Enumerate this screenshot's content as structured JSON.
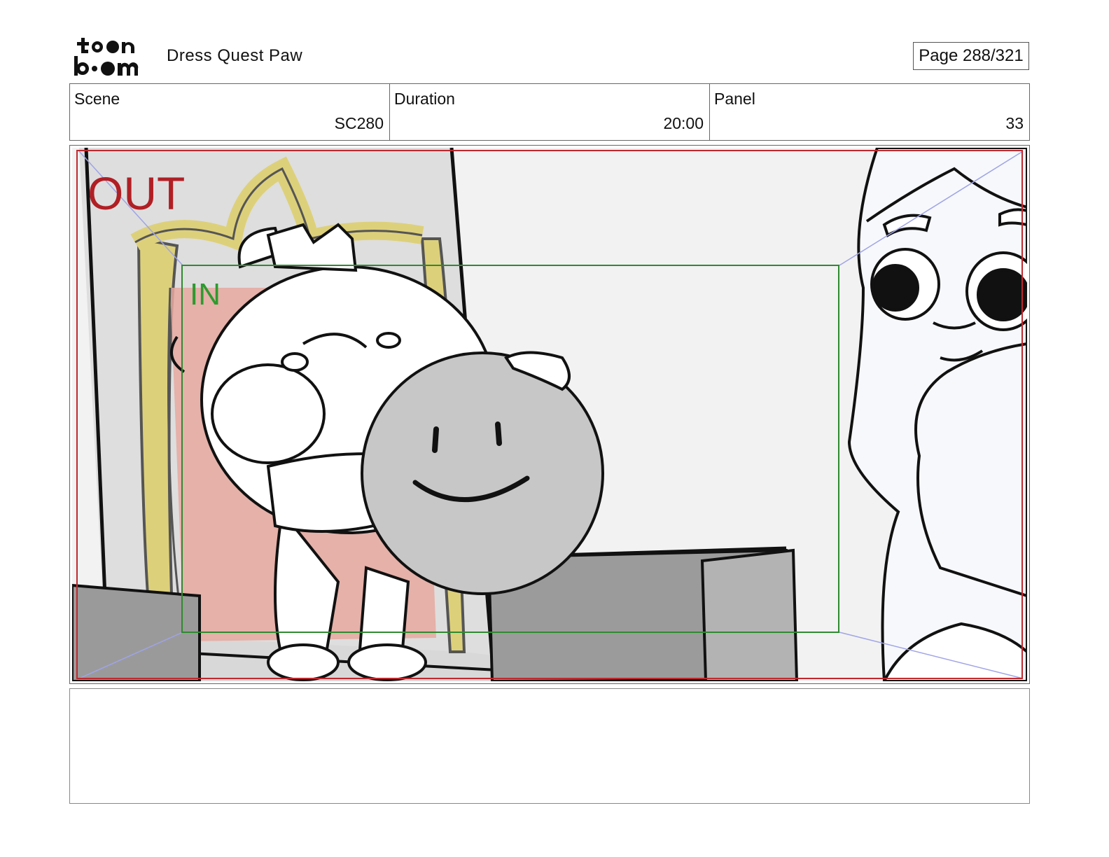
{
  "header": {
    "logo_text_top": "toon",
    "logo_text_bottom": "boom",
    "project_title": "Dress Quest Paw",
    "page_indicator": "Page 288/321"
  },
  "info": {
    "scene_label": "Scene",
    "scene_value": "SC280",
    "duration_label": "Duration",
    "duration_value": "20:00",
    "panel_label": "Panel",
    "panel_value": "33"
  },
  "panel": {
    "out_label": "OUT",
    "in_label": "IN"
  },
  "colors": {
    "out_frame": "#c0282d",
    "in_frame": "#2f8a2f",
    "throne_gold": "#ddd07a",
    "throne_red": "#e6a9a0",
    "balloon_gray": "#c7c7c7"
  },
  "notes": {
    "text": ""
  }
}
